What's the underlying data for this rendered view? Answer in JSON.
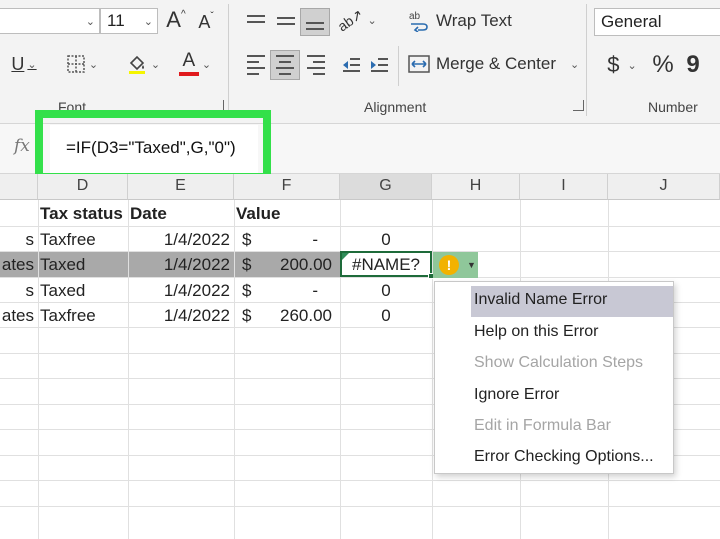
{
  "ribbon": {
    "font_size": "11",
    "grow_font": "A",
    "shrink_font": "A",
    "wrap_text_label": "Wrap Text",
    "merge_center_label": "Merge & Center",
    "number_format": "General",
    "currency_symbol": "$",
    "percent_symbol": "%",
    "comma_symbol": "9",
    "font_group_label": "Font",
    "alignment_group_label": "Alignment",
    "number_group_label": "Number",
    "underline": "U",
    "font_color_letter": "A",
    "font_color": "#e0191d"
  },
  "formula_bar": {
    "fx_label": "fx",
    "formula": "=IF(D3=\"Taxed\",G,\"0\")"
  },
  "columns": [
    "D",
    "E",
    "F",
    "G",
    "H",
    "I",
    "J"
  ],
  "rows": [
    {
      "c": "",
      "d": "Tax status",
      "e": "Date",
      "f_sym": "Value",
      "f_val": "",
      "g": ""
    },
    {
      "c": "s",
      "d": "Taxfree",
      "e": "1/4/2022",
      "f_sym": "$",
      "f_val": "-",
      "g": "0"
    },
    {
      "c": "ates",
      "d": "Taxed",
      "e": "1/4/2022",
      "f_sym": "$",
      "f_val": "200.00",
      "g": "#NAME?"
    },
    {
      "c": "s",
      "d": "Taxed",
      "e": "1/4/2022",
      "f_sym": "$",
      "f_val": "-",
      "g": "0"
    },
    {
      "c": "ates",
      "d": "Taxfree",
      "e": "1/4/2022",
      "f_sym": "$",
      "f_val": "260.00",
      "g": "0"
    }
  ],
  "error_button": {
    "icon": "warning-icon",
    "glyph": "!"
  },
  "context_menu": {
    "items": [
      {
        "label": "Invalid Name Error",
        "state": "hover"
      },
      {
        "label": "Help on this Error",
        "state": "enabled"
      },
      {
        "label": "Show Calculation Steps",
        "state": "disabled"
      },
      {
        "label": "Ignore Error",
        "state": "enabled"
      },
      {
        "label": "Edit in Formula Bar",
        "state": "disabled"
      },
      {
        "label": "Error Checking Options...",
        "state": "enabled"
      }
    ]
  },
  "colors": {
    "highlight": "#33e04a",
    "selected_row": "#a9a9a9",
    "cell_border": "#1e6b3a",
    "warning": "#f2b200"
  }
}
